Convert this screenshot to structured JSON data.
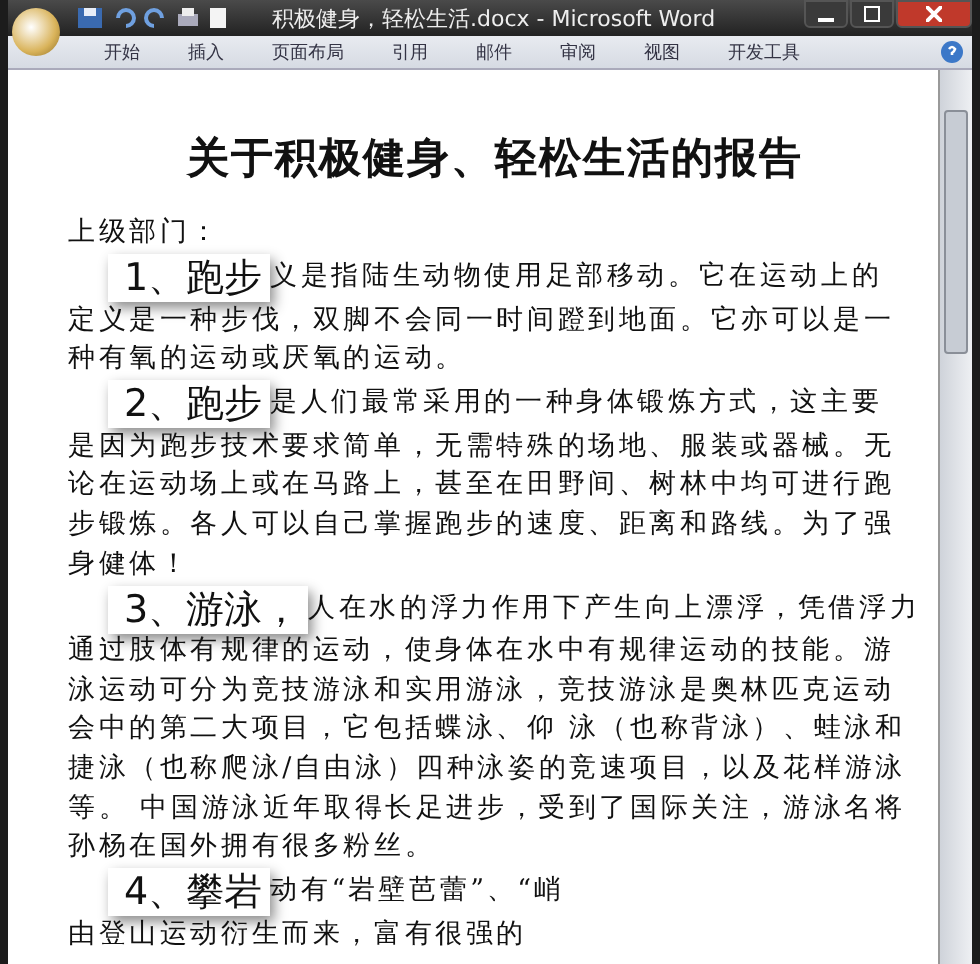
{
  "window": {
    "title": "积极健身，轻松生活.docx - Microsoft Word"
  },
  "tabs": [
    {
      "label": "开始"
    },
    {
      "label": "插入"
    },
    {
      "label": "页面布局"
    },
    {
      "label": "引用"
    },
    {
      "label": "邮件"
    },
    {
      "label": "审阅"
    },
    {
      "label": "视图"
    },
    {
      "label": "开发工具"
    }
  ],
  "document": {
    "title": "关于积极健身、轻松生活的报告",
    "salutation": "上级部门：",
    "paragraphs": [
      {
        "callout": "1、跑步",
        "lines": [
          "义是指陆生动物使用足部移动。它在运动上的",
          "定义是一种步伐，双脚不会同一时间蹬到地面。它亦可以是一",
          "种有氧的运动或厌氧的运动。"
        ]
      },
      {
        "callout": "2、跑步",
        "lines": [
          "是人们最常采用的一种身体锻炼方式，这主要",
          "是因为跑步技术要求简单，无需特殊的场地、服装或器械。无",
          "论在运动场上或在马路上，甚至在田野间、树林中均可进行跑",
          "步锻炼。各人可以自己掌握跑步的速度、距离和路线。为了强",
          "身健体！"
        ]
      },
      {
        "callout": "3、游泳，",
        "lines": [
          "人在水的浮力作用下产生向上漂浮，凭借浮力",
          "通过肢体有规律的运动，使身体在水中有规律运动的技能。游",
          "泳运动可分为竞技游泳和实用游泳，竞技游泳是奥林匹克运动",
          "会中的第二大项目，它包括蝶泳、仰 泳（也称背泳）、蛙泳和",
          "捷泳（也称爬泳/自由泳）四种泳姿的竞速项目，以及花样游泳",
          "等。 中国游泳近年取得长足进步，受到了国际关注，游泳名将",
          "孙杨在国外拥有很多粉丝。"
        ]
      },
      {
        "callout": "4、攀岩",
        "lines": [
          "动有“岩壁芭蕾”、“峭",
          "由登山运动衍生而来，富有很强的"
        ]
      }
    ]
  }
}
